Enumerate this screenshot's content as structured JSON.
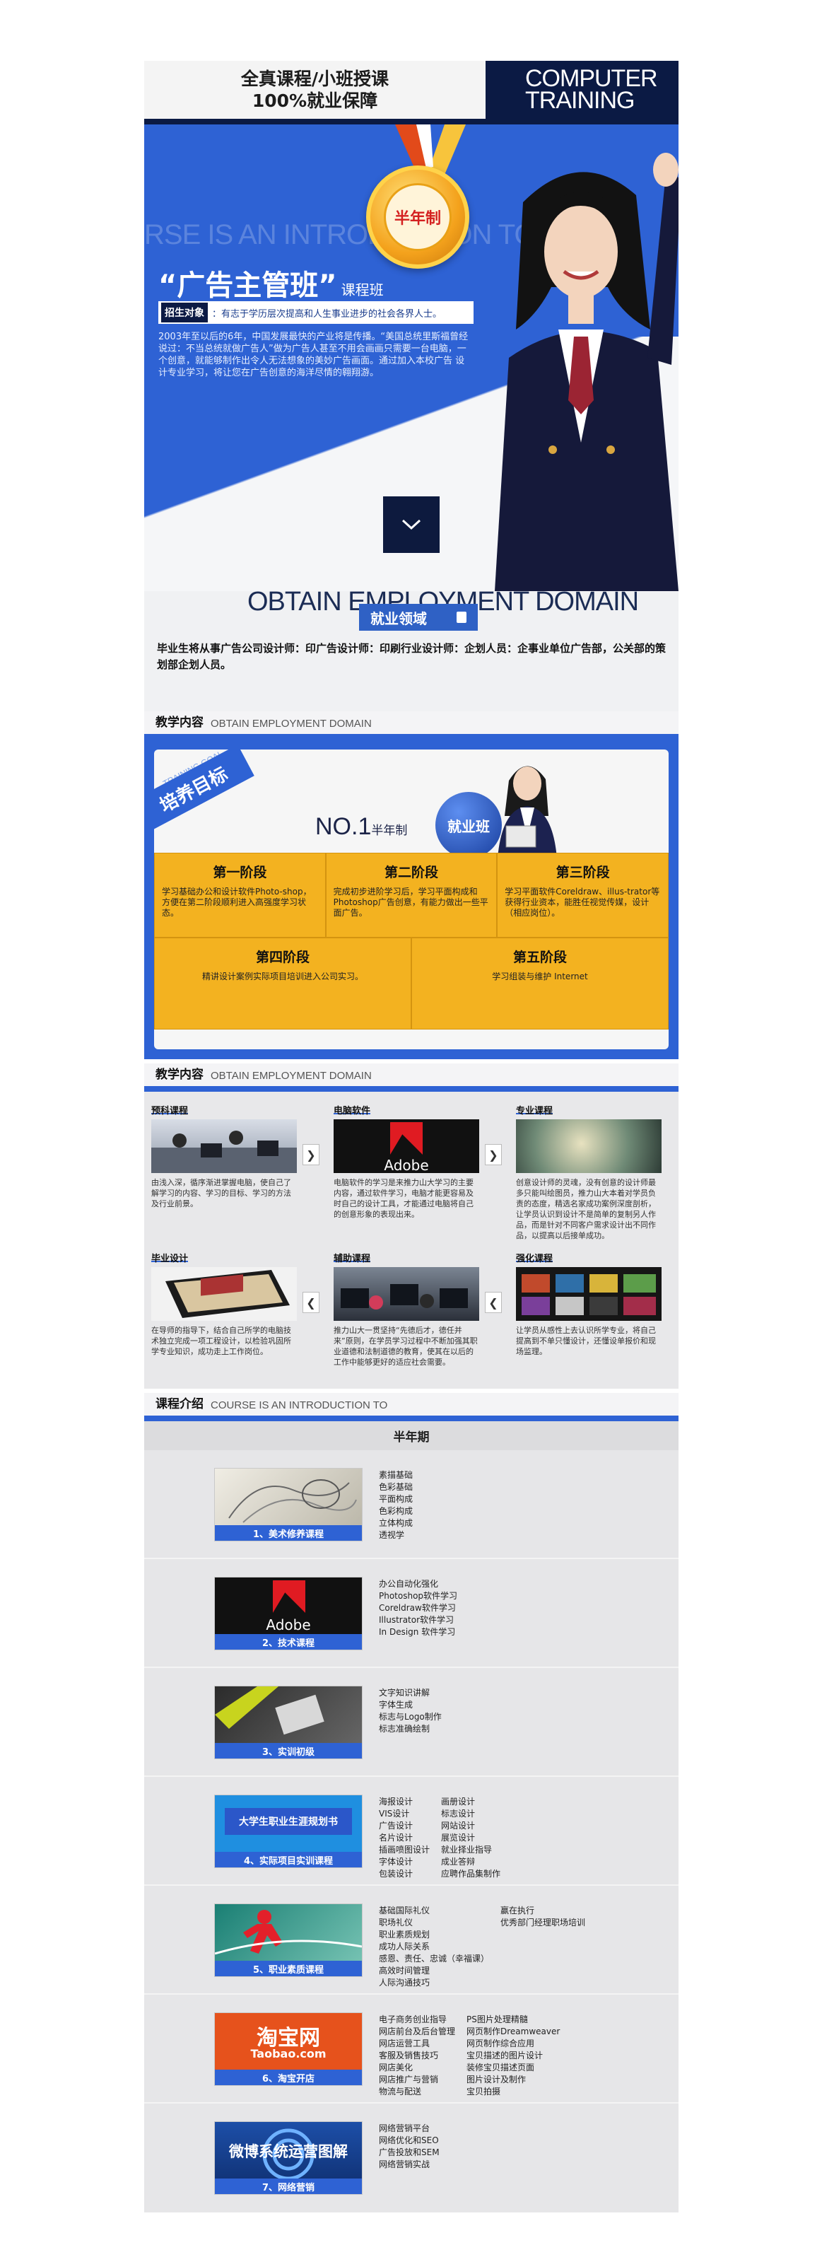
{
  "hero": {
    "slogan_line1": "全真课程/小班授课",
    "slogan_line2": "100%就业保障",
    "brand_line1": "COMPUTER",
    "brand_line2": "TRAINING",
    "watermark": "RSE IS AN INTRODUCTION TO",
    "medal_text": "半年制",
    "title": "“广告主管班”",
    "title_suffix": "课程班",
    "target_tag": "招生对象",
    "target_text": "：有志于学历层次提高和人生事业进步的社会各界人士。",
    "intro": "2003年至以后的6年，中国发展最快的产业将是传播。“美国总统里斯福曾经说过：不当总统就做广告人”做为广告人甚至不用会画画只需要一台电脑，一个创意，就能够制作出令人无法想象的美妙广告画面。通过加入本校广告 设计专业学习，将让您在广告创意的海洋尽情的翱翔游。"
  },
  "employment": {
    "heading_en": "OBTAIN EMPLOYMENT DOMAIN",
    "pill": "就业领域",
    "desc": "毕业生将从事广告公司设计师：印广告设计师：印刷行业设计师：企划人员：企事业单位广告部，公关部的策划部企划人员。"
  },
  "goal": {
    "head_cn": "教学内容",
    "head_en": "OBTAIN EMPLOYMENT DOMAIN",
    "banner": "培养目标",
    "banner_en": "TRAINING GOAL",
    "no1": "NO.1",
    "no1_suffix": "半年制",
    "badge": "就业班",
    "stages": [
      {
        "title": "第一阶段",
        "desc": "学习基础办公和设计软件Photo-shop，方便在第二阶段顺利进入高强度学习状态。"
      },
      {
        "title": "第二阶段",
        "desc": "完成初步进阶学习后，学习平面构成和Photoshop广告创意，有能力做出一些平面广告。"
      },
      {
        "title": "第三阶段",
        "desc": "学习平面软件Coreldraw、illus-trator等获得行业资本，能胜任视觉传媒，设计（相应岗位）。"
      },
      {
        "title": "第四阶段",
        "desc": "精讲设计案例实际项目培训进入公司实习。"
      },
      {
        "title": "第五阶段",
        "desc": "学习组装与维护 Internet"
      }
    ]
  },
  "content": {
    "head_cn": "教学内容",
    "head_en": "OBTAIN EMPLOYMENT DOMAIN",
    "items": [
      {
        "label": "预科课程",
        "text": "由浅入深，循序渐进掌握电脑，使自己了解学习的内容、学习的目标、学习的方法及行业前景。"
      },
      {
        "label": "电脑软件",
        "text": "电脑软件的学习是来推力山大学习的主要内容，通过软件学习，电脑才能更容易及时自己的设计工具，才能通过电脑将自己的创意形象的表现出来。"
      },
      {
        "label": "专业课程",
        "text": "创意设计师的灵魂，没有创意的设计师最多只能叫绘图员，推力山大本着对学员负责的态度，精选名家成功案例深度剖析，让学员认识到设计不是简单的复制另人作品，而是针对不同客户需求设计出不同作品，以提高以后接单成功。"
      },
      {
        "label": "毕业设计",
        "text": "在导师的指导下，结合自己所学的电脑技术独立完成一项工程设计，以检验巩固所学专业知识，成功走上工作岗位。"
      },
      {
        "label": "辅助课程",
        "text": "推力山大一贯坚持“先德后才，德任并来”原则，在学员学习过程中不断加强其职业道德和法制道德的教育，使其在以后的工作中能够更好的适应社会需要。"
      },
      {
        "label": "强化课程",
        "text": "让学员从感性上去认识所学专业，将自己提高到不单只懂设计，还懂设单报价和现场监理。"
      }
    ],
    "adobe_text": "Adobe"
  },
  "courses": {
    "head_cn": "课程介绍",
    "head_en": "COURSE IS AN INTRODUCTION TO",
    "period": "半年期",
    "list": [
      {
        "caption": "1、美术修养课程",
        "items": [
          "素描基础",
          "色彩基础",
          "平面构成",
          "色彩构成",
          "立体构成",
          "透视学"
        ]
      },
      {
        "caption": "2、技术课程",
        "items": [
          "办公自动化强化",
          "Photoshop软件学习",
          "Coreldraw软件学习",
          "Illustrator软件学习",
          "In Design 软件学习"
        ],
        "thumb_text": "Adobe"
      },
      {
        "caption": "3、实训初级",
        "items": [
          "文字知识讲解",
          "字体生成",
          "标志与Logo制作",
          "标志准确绘制"
        ]
      },
      {
        "caption": "4、实际项目实训课程",
        "thumb_text": "大学生职业生涯规划书",
        "items": [
          "海报设计",
          "VIS设计",
          "广告设计",
          "名片设计",
          "插画喷图设计",
          "字体设计",
          "包装设计",
          "画册设计",
          "标志设计",
          "网站设计",
          "展览设计",
          "就业择业指导",
          "成业答辩",
          "应聘作品集制作"
        ]
      },
      {
        "caption": "5、职业素质课程",
        "items": [
          "基础国际礼仪",
          "职场礼仪",
          "职业素质规划",
          "成功人际关系",
          "感恩、责任、忠诚（幸福课）",
          "高效时间管理",
          "人际沟通技巧",
          "赢在执行",
          "优秀部门经理职场培训"
        ]
      },
      {
        "caption": "6、淘宝开店",
        "thumb_text": "淘宝网",
        "thumb_sub": "Taobao.com",
        "items": [
          "电子商务创业指导",
          "网店前台及后台管理",
          "网店运营工具",
          "客服及销售技巧",
          "网店美化",
          "网店推广与营销",
          "物流与配送",
          "PS图片处理精髓",
          "网页制作Dreamweaver",
          "网页制作综合应用",
          "宝贝描述的图片设计",
          "装修宝贝描述页面",
          "图片设计及制作",
          "宝贝拍摄"
        ]
      },
      {
        "caption": "7、网络营销",
        "thumb_text": "微博系统运营图解",
        "items": [
          "网络营销平台",
          "网络优化和SEO",
          "广告投放和SEM",
          "网络营销实战"
        ]
      }
    ]
  },
  "colors": {
    "accent": "#2e62d4",
    "navy": "#0b1a44",
    "stage": "#f3b220"
  }
}
